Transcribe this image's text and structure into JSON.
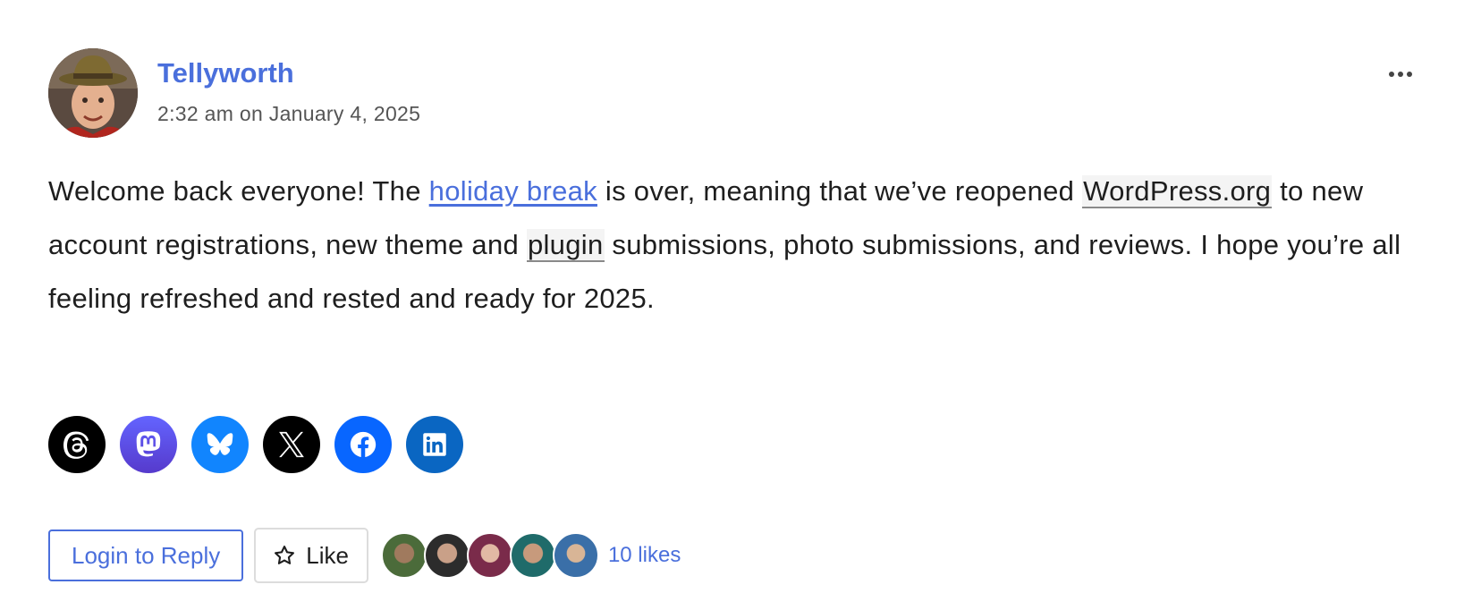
{
  "post": {
    "author": "Tellyworth",
    "timestamp": "2:32 am on January 4, 2025",
    "more_icon": "more-horizontal-icon",
    "body": {
      "p1": "Welcome back everyone! The ",
      "link_holiday_break": "holiday break",
      "p2": " is over, meaning that we’ve reopened ",
      "term_wordpress": "WordPress.org",
      "p3": " to new account registrations, new theme and ",
      "term_plugin": "plugin",
      "p4": " submissions, photo submissions, and reviews. I hope you’re all feeling refreshed and rested and ready for 2025."
    }
  },
  "share": {
    "items": [
      {
        "icon": "threads-icon",
        "color": "#000000"
      },
      {
        "icon": "mastodon-icon",
        "color": "#6364ff"
      },
      {
        "icon": "bluesky-icon",
        "color": "#1185fe"
      },
      {
        "icon": "x-icon",
        "color": "#000000"
      },
      {
        "icon": "facebook-icon",
        "color": "#0866ff"
      },
      {
        "icon": "linkedin-icon",
        "color": "#0a66c2"
      }
    ]
  },
  "actions": {
    "login_label": "Login to Reply",
    "like_label": "Like",
    "like_icon": "star-icon",
    "likes_count": "10 likes",
    "liker_avatar_count_shown": 5
  },
  "colors": {
    "link": "#4a6fdc",
    "text": "#1e1e1e",
    "muted": "#555555"
  }
}
